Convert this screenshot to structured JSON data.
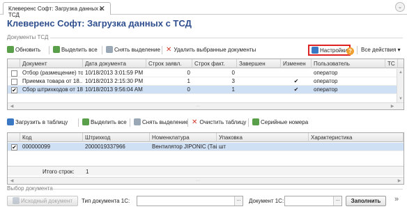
{
  "tab": {
    "title": "Клеверенс Софт: Загрузка данных с ТСД",
    "close": "✕"
  },
  "window_button": "⌄",
  "page_title": "Клеверенс Софт: Загрузка данных с ТСД",
  "documents_group": {
    "label": "Документы ТСД",
    "toolbar": {
      "refresh": "Обновить",
      "select_all": "Выделить все",
      "deselect": "Снять выделение",
      "delete_selected": "Удалить выбранные документы",
      "settings": "Настройки",
      "help": "?",
      "all_actions": "Все действия ▾"
    },
    "columns": [
      "Документ",
      "Дата документа",
      "Строк заявл.",
      "Строк факт.",
      "Завершен",
      "Изменен",
      "Пользователь",
      "ТС ▲"
    ],
    "rows": [
      {
        "checked": false,
        "document": "Отбор (размещение) то...",
        "date": "10/18/2013 3:01:59 PM",
        "planned": "0",
        "actual": "0",
        "done": "",
        "changed": "",
        "user": "оператор"
      },
      {
        "checked": false,
        "document": "Приемка товара от 18....",
        "date": "10/18/2013 2:15:30 PM",
        "planned": "1",
        "actual": "3",
        "done": "",
        "changed": "✔",
        "user": "оператор"
      },
      {
        "checked": true,
        "document": "Сбор штрихкодов от 18...",
        "date": "10/18/2013 9:56:04 AM",
        "planned": "0",
        "actual": "1",
        "done": "",
        "changed": "✔",
        "user": "оператор"
      }
    ]
  },
  "items_toolbar": {
    "load_to_table": "Загрузить в таблицу",
    "select_all": "Выделить все",
    "deselect": "Снять выделение",
    "clear_table": "Очистить таблицу",
    "serial_numbers": "Серийные номера"
  },
  "items_table": {
    "columns": [
      "Код",
      "Штрихкод",
      "Номенклатура",
      "Упаковка",
      "Характеристика"
    ],
    "rows": [
      {
        "checked": true,
        "code": "000000099",
        "barcode": "2000019337966",
        "item": "Вентилятор JIPONIC (Тай...",
        "pack": "шт",
        "feature": ""
      }
    ],
    "total_label": "Итого строк:",
    "total_value": "1"
  },
  "doc_choice": {
    "label": "Выбор документа",
    "source_button": "Исходный документ",
    "type_label": "Тип документа 1С:",
    "type_value": "",
    "doc_label": "Документ 1С:",
    "doc_value": "",
    "fill_button": "Заполнить",
    "more": "»"
  }
}
